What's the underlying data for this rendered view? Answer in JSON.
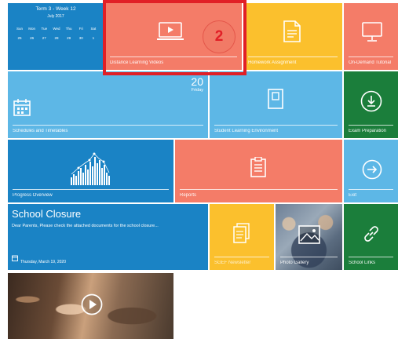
{
  "calendar": {
    "term": "Term 3 - Week 12",
    "month": "July 2017",
    "days": [
      "Sun",
      "Mon",
      "Tue",
      "Wed",
      "Thu",
      "Fri",
      "Sat"
    ],
    "dates": [
      "25",
      "26",
      "27",
      "28",
      "29",
      "30",
      "1"
    ]
  },
  "tiles": {
    "distance_learning": "Distance Learning Videos",
    "homework": "Homework Assignment",
    "on_demand": "On-Demand Tutorial",
    "schedules": "Schedules and Timetables",
    "schedules_date": "20",
    "schedules_day": "Friday",
    "student_learning": "Student Learning Environment",
    "exam_prep": "Exam Preparation",
    "progress": "Progress Overview",
    "reports": "Reports",
    "exit": "Exit",
    "newsletter": "SGEF Newsletter",
    "photo_gallery": "Photo Gallery",
    "school_links": "School Links"
  },
  "news": {
    "title": "School Closure",
    "body": "Dear Parents, Please check the attached documents for the school closure...",
    "date": "Thursday, March 19, 2020"
  },
  "callout": {
    "number": "2"
  },
  "colors": {
    "blue_dark": "#1a83c5",
    "blue_light": "#5db7e6",
    "salmon": "#f47c68",
    "yellow": "#fbc02d",
    "green": "#1b7e3b",
    "highlight": "#e11f26"
  },
  "icons": [
    "video-player-icon",
    "document-icon",
    "monitor-icon",
    "calendar-icon",
    "book-icon",
    "download-icon",
    "bar-chart-icon",
    "clipboard-icon",
    "arrow-right-circle-icon",
    "newsletter-icon",
    "picture-icon",
    "link-icon",
    "play-icon"
  ]
}
